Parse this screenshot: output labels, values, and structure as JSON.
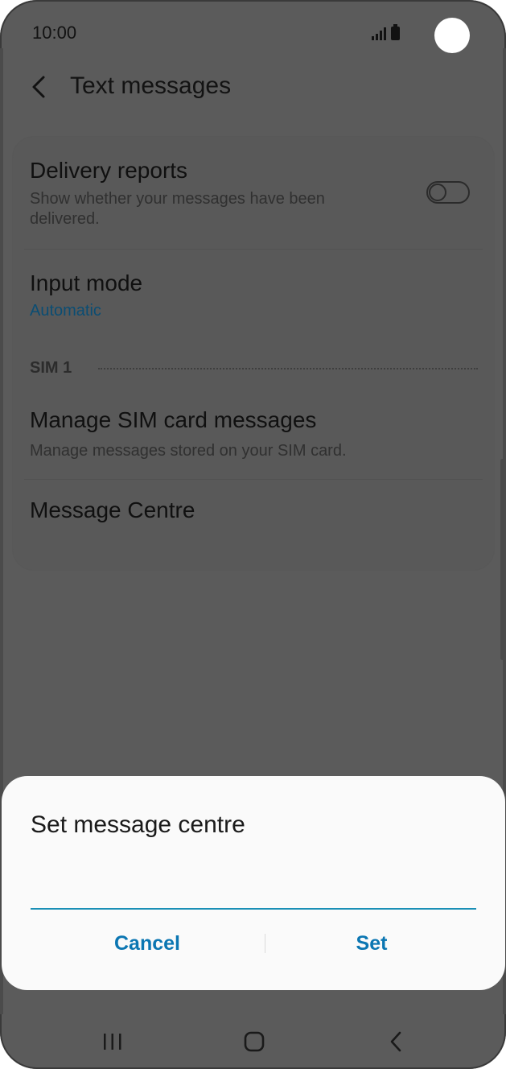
{
  "status_bar": {
    "time": "10:00",
    "signal_icon": "signal-icon",
    "battery_icon": "battery-icon"
  },
  "header": {
    "back_icon": "back-arrow-icon",
    "title": "Text messages"
  },
  "settings": {
    "delivery_reports": {
      "title": "Delivery reports",
      "description": "Show whether your messages have been delivered.",
      "toggle_on": false
    },
    "input_mode": {
      "title": "Input mode",
      "value": "Automatic"
    },
    "section_label": "SIM 1",
    "manage_sim": {
      "title": "Manage SIM card messages",
      "description": "Manage messages stored on your SIM card."
    },
    "message_centre": {
      "title": "Message Centre"
    }
  },
  "dialog": {
    "title": "Set message centre",
    "input_value": "",
    "cancel_label": "Cancel",
    "set_label": "Set"
  },
  "nav_bar": {
    "recent_icon": "recent-apps-icon",
    "home_icon": "home-icon",
    "back_icon": "nav-back-icon"
  },
  "colors": {
    "accent": "#0b76b2",
    "input_underline": "#1a8fb6",
    "value_text": "#0b4d73",
    "dim_background": "#5b5b5b",
    "dialog_background": "#fafafa"
  }
}
